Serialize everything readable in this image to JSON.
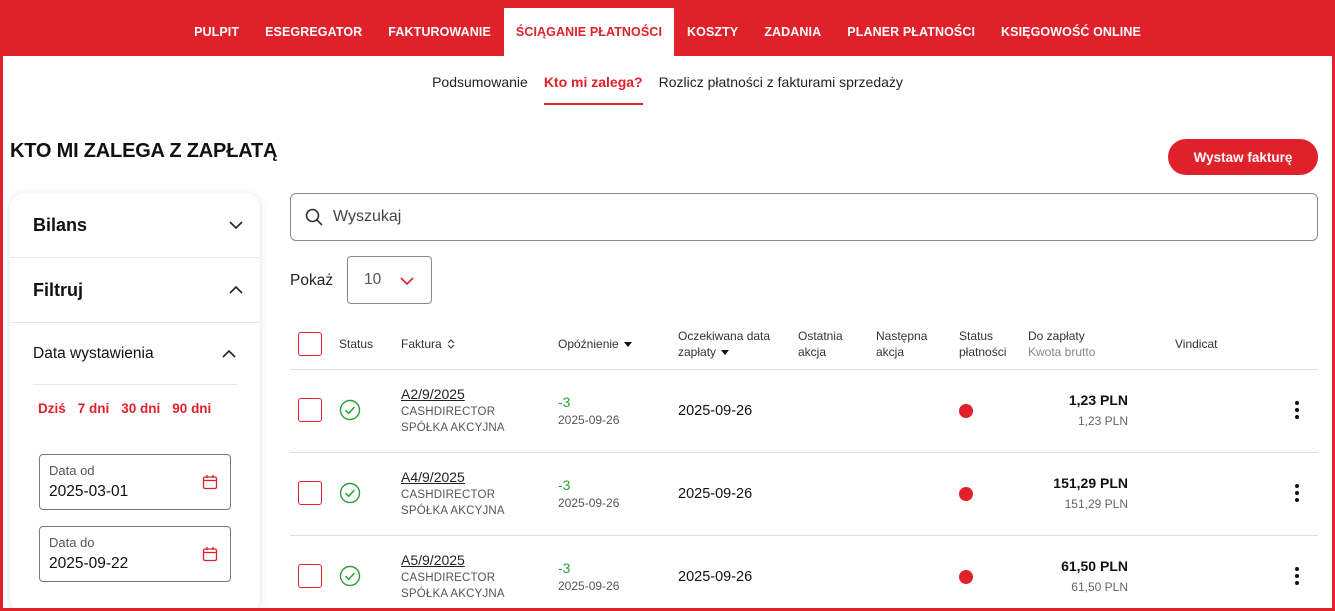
{
  "nav": {
    "items": [
      {
        "label": "PULPIT"
      },
      {
        "label": "ESEGREGATOR"
      },
      {
        "label": "FAKTUROWANIE"
      },
      {
        "label": "ŚCIĄGANIE PŁATNOŚCI",
        "active": true
      },
      {
        "label": "KOSZTY"
      },
      {
        "label": "ZADANIA"
      },
      {
        "label": "PLANER PŁATNOŚCI"
      },
      {
        "label": "KSIĘGOWOŚĆ ONLINE"
      }
    ]
  },
  "subnav": {
    "items": [
      {
        "label": "Podsumowanie"
      },
      {
        "label": "Kto mi zalega?",
        "active": true
      },
      {
        "label": "Rozlicz płatności z fakturami sprzedaży"
      }
    ]
  },
  "page": {
    "title": "KTO MI ZALEGA Z ZAPŁATĄ",
    "primary_button": "Wystaw fakturę"
  },
  "sidebar": {
    "balance_title": "Bilans",
    "filter_title": "Filtruj",
    "issue_date_title": "Data wystawienia",
    "quick_ranges": [
      "Dziś",
      "7 dni",
      "30 dni",
      "90 dni"
    ],
    "date_from": {
      "label": "Data od",
      "value": "2025-03-01"
    },
    "date_to": {
      "label": "Data do",
      "value": "2025-09-22"
    }
  },
  "search": {
    "placeholder": "Wyszukaj"
  },
  "pagination": {
    "show_label": "Pokaż",
    "page_size": "10"
  },
  "table": {
    "headers": {
      "status": "Status",
      "invoice": "Faktura",
      "delay": "Opóźnienie",
      "expected_date_1": "Oczekiwana data",
      "expected_date_2": "zapłaty",
      "last_action_1": "Ostatnia",
      "last_action_2": "akcja",
      "next_action_1": "Następna",
      "next_action_2": "akcja",
      "payment_status_1": "Status",
      "payment_status_2": "płatności",
      "to_pay": "Do zapłaty",
      "gross": "Kwota brutto",
      "vindicat": "Vindicat"
    },
    "rows": [
      {
        "invoice": "A2/9/2025",
        "client_1": "CASHDIRECTOR",
        "client_2": "SPÓŁKA AKCYJNA",
        "delay": "-3",
        "delay_date": "2025-09-26",
        "due_date": "2025-09-26",
        "amount": "1,23 PLN",
        "gross": "1,23 PLN"
      },
      {
        "invoice": "A4/9/2025",
        "client_1": "CASHDIRECTOR",
        "client_2": "SPÓŁKA AKCYJNA",
        "delay": "-3",
        "delay_date": "2025-09-26",
        "due_date": "2025-09-26",
        "amount": "151,29 PLN",
        "gross": "151,29 PLN"
      },
      {
        "invoice": "A5/9/2025",
        "client_1": "CASHDIRECTOR",
        "client_2": "SPÓŁKA AKCYJNA",
        "delay": "-3",
        "delay_date": "2025-09-26",
        "due_date": "2025-09-26",
        "amount": "61,50 PLN",
        "gross": "61,50 PLN"
      }
    ]
  },
  "colors": {
    "accent": "#e0202a",
    "ok": "#2e9e3a"
  }
}
